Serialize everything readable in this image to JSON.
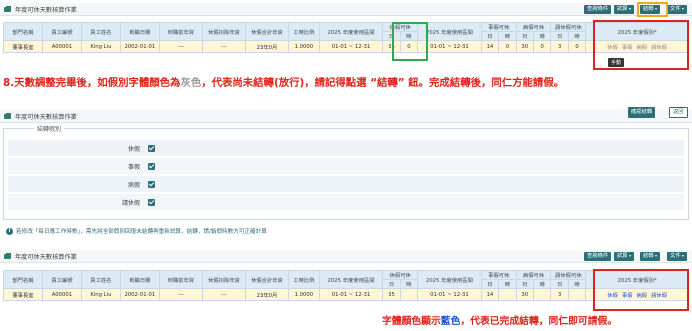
{
  "screen1": {
    "title": "年度可休天數核算作業",
    "buttons": {
      "query": "查詢條件",
      "trial": "試算",
      "transfer": "結轉",
      "file": "文件"
    },
    "headers": [
      "部門名稱",
      "員工編號",
      "員工姓名",
      "到職日期",
      "到職前年資",
      "休假扣除年資",
      "休假合計年資",
      "工時比例",
      "2025 年度使用區間",
      "休假可休",
      "2025 年度使用區間",
      "事假可休",
      "病假可休",
      "請休假可休",
      "2025 年度假別*"
    ],
    "subheaders": [
      "日",
      "時",
      "日",
      "時",
      "日",
      "時",
      "日",
      "時"
    ],
    "row": {
      "dept": "董事長室",
      "emp_no": "A00001",
      "name": "King Liu",
      "hire_date": "2002-01-01",
      "prior": "---",
      "deduct": "---",
      "total": "23年0月",
      "ratio": "1.0000",
      "range1": "01-01 ~ 12-31",
      "annual_d": "35",
      "annual_h": "0",
      "range2": "01-01 ~ 12-31",
      "personal_d": "14",
      "personal_h": "0",
      "sick_d": "30",
      "sick_h": "0",
      "other_d": "3",
      "other_h": "0"
    },
    "leave_types": [
      "休假",
      "事假",
      "病假",
      "請休假"
    ],
    "tooltip": "手動"
  },
  "annotation_top": {
    "pre": "8.天數調整完畢後，如假別字體顏色為",
    "grey": "灰色",
    "post": "，代表尚未結轉(放行)，請記得點選 “結轉” 鈕。完成結轉後，同仁方能請假。"
  },
  "screen2": {
    "title": "年度可休天數核算作業",
    "buttons": {
      "confirm": "確認結轉",
      "back": "返回"
    },
    "panel_legend": "結轉假別",
    "items": [
      "休假",
      "事假",
      "病假",
      "請休假"
    ],
    "info": "若修改「每日應工作時數」，需先將全部假別回復未結轉再重新試算，結轉，請/銷假時數方可正確計算"
  },
  "screen3": {
    "title": "年度可休天數核算作業",
    "buttons": {
      "query": "查詢條件",
      "trial": "試算",
      "transfer": "結轉",
      "file": "文件"
    },
    "row": {
      "dept": "董事長室",
      "emp_no": "A00001",
      "name": "King Liu",
      "hire_date": "2002-01-01",
      "prior": "---",
      "deduct": "---",
      "total": "23年0月",
      "ratio": "1.0000",
      "range1": "01-01 ~ 12-31",
      "annual_d": "35",
      "annual_h": "",
      "range2": "01-01 ~ 12-31",
      "personal_d": "14",
      "personal_h": "",
      "sick_d": "30",
      "sick_h": "",
      "other_d": "3",
      "other_h": ""
    }
  },
  "annotation_bottom": {
    "pre": "字體顏色顯示",
    "blue": "藍色",
    "post": "，代表已完成結轉，同仁即可請假。"
  },
  "colors": {
    "accent": "#2e6e78",
    "red": "#e0241b",
    "green": "#2fa84f",
    "orange": "#f0a81c",
    "blue": "#1d4fd0"
  }
}
